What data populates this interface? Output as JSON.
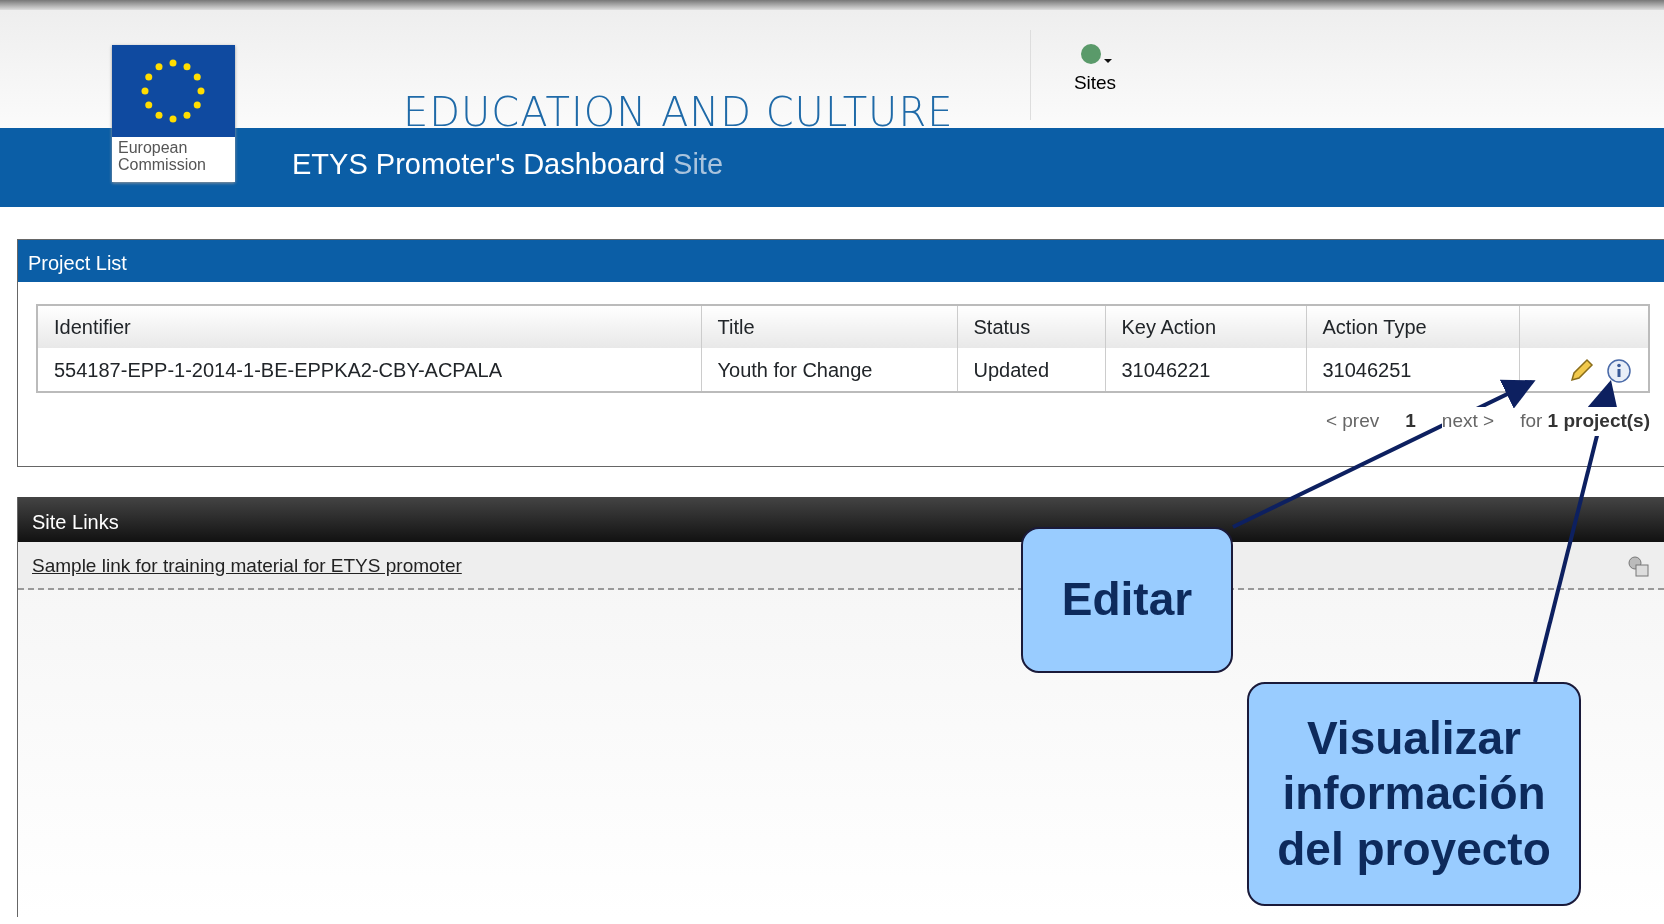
{
  "header": {
    "logo_text": "European Commission",
    "department": "EDUCATION AND CULTURE",
    "sites_menu": {
      "label": "Sites"
    },
    "site_title": "ETYS Promoter's Dashboard",
    "site_suffix": "Site"
  },
  "project_list": {
    "title": "Project List",
    "table": {
      "columns": [
        "Identifier",
        "Title",
        "Status",
        "Key Action",
        "Action Type"
      ],
      "rows": [
        {
          "cells": [
            "554187-EPP-1-2014-1-BE-EPPKA2-CBY-ACPALA",
            "Youth for Change",
            "Updated",
            "31046221",
            "31046251"
          ]
        }
      ]
    },
    "pagination": {
      "prev": "< prev",
      "page": "1",
      "next": "next >",
      "summary": "for **1 project(s)**"
    }
  },
  "site_links": {
    "title": "Site Links",
    "links": [
      "Sample link for training material for ETYS promoter"
    ]
  },
  "annotations": [
    {
      "text": "Editar",
      "kind": "edit"
    },
    {
      "text": "Visualizar información del proyecto",
      "kind": "info"
    }
  ]
}
